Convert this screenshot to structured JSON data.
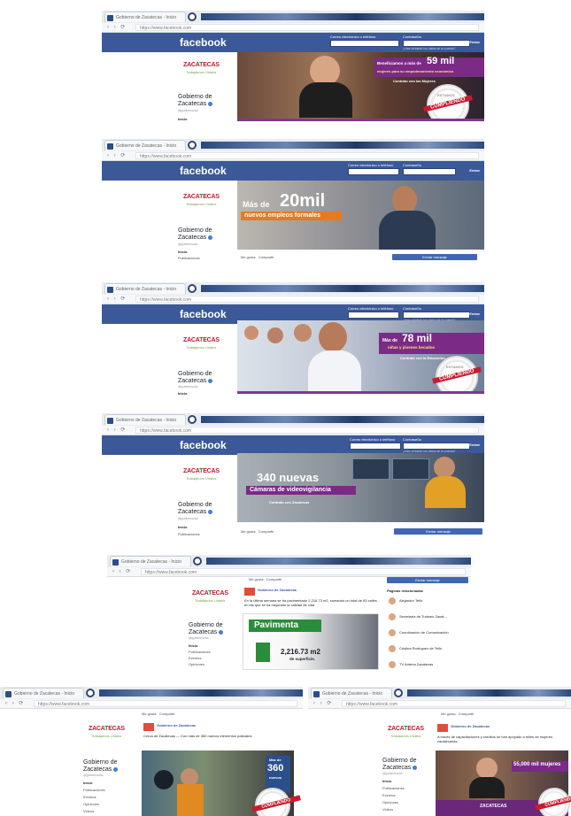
{
  "browser": {
    "tab_title": "Gobierno de Zacatecas - Inicio",
    "nav_glyphs": "‹ › ⟳",
    "url": "https://www.facebook.com"
  },
  "facebook": {
    "logo": "facebook",
    "email_label": "Correo electrónico o teléfono",
    "password_label": "Contraseña",
    "login": "Entrar",
    "forgot": "¿Has olvidado los datos de la cuenta?"
  },
  "page": {
    "logo_main": "ZACA",
    "logo_x": "T",
    "logo_rest": "ECAS",
    "logo_sub": "Trabajamos Unidos",
    "name_line1": "Gobierno de",
    "name_line2": "Zacatecas",
    "handle": "@gobiernozac",
    "nav_home": "Inicio",
    "nav_posts": "Publicaciones",
    "nav_events": "Eventos",
    "nav_reviews": "Opiniones",
    "nav_videos": "Videos"
  },
  "covers": {
    "c1_line1": "Beneficiamos a más de",
    "c1_big": "59 mil",
    "c1_line2": "mujeres para su empoderamiento económico",
    "c1_tag": "Contrato con las Mujeres",
    "c2_pre": "Más de",
    "c2_big": "20mil",
    "c2_line": "nuevos empleos formales",
    "c3_pre": "Más de",
    "c3_big": "78 mil",
    "c3_line": "niñas y jóvenes becados",
    "c3_tag": "Contrato con la Educación",
    "c4_big": "340 nuevas",
    "c4_line": "Cámaras de videovigilancia",
    "c4_tag": "Contrato con Zacatecas",
    "stamp_top": "ESTAMOS",
    "stamp": "CUMPLIENDO",
    "stamp_bottom": "ZACATECAS"
  },
  "actions": {
    "like": "Me gusta",
    "share": "Compartir",
    "message": "Enviar mensaje"
  },
  "post": {
    "author": "Gobierno de Zacatecas",
    "text": "En la última semana se ha pavimentado 2,216.73 m2, sumando un total de 83 calles en las que se ha mejorado la calidad de vida",
    "banner_title": "Pavimenta",
    "banner_value": "2,216.73 m2",
    "banner_unit": "de superficie.",
    "post6_text": "Cerca de Zacatecas — Con más de 360 nuevos elementos policiales",
    "post6_badge_pre": "Más de",
    "post6_badge_num": "360",
    "post6_badge_post": "nuevos",
    "post7_text": "A través de capacitaciones y créditos se han apoyado a miles de mujeres zacatecanas",
    "post7_banner": "55,000 mil mujeres",
    "post7_logo": "ZACATECAS"
  },
  "sidebar": {
    "title": "Páginas relacionadas",
    "items": [
      "Alejandro Tello",
      "Secretaría de Turismo Zacat...",
      "Coordinación de Comunicación",
      "Cristina Rodríguez de Tello",
      "TV Antena Zacatecas"
    ]
  }
}
